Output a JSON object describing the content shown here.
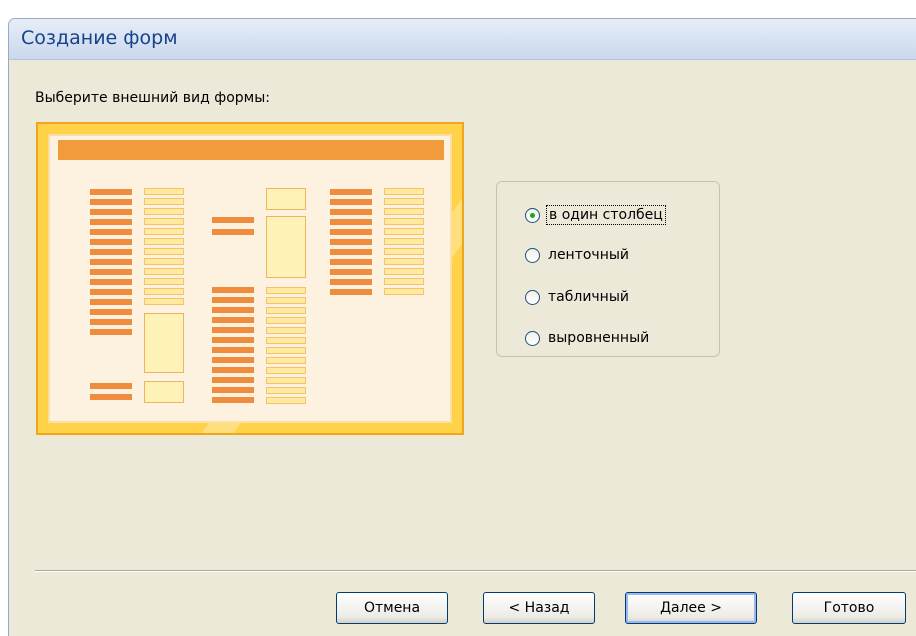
{
  "window": {
    "title": "Создание форм"
  },
  "prompt": "Выберите внешний вид формы:",
  "layout_options": [
    {
      "label": "в один столбец",
      "checked": true,
      "focused": true
    },
    {
      "label": "ленточный",
      "checked": false,
      "focused": false
    },
    {
      "label": "табличный",
      "checked": false,
      "focused": false
    },
    {
      "label": "выровненный",
      "checked": false,
      "focused": false
    }
  ],
  "buttons": {
    "cancel": "Отмена",
    "back": "< Назад",
    "next": "Далее >",
    "finish": "Готово"
  },
  "colors": {
    "title_text": "#15428b",
    "preview_orange": "#f29b3d",
    "preview_gold": "#ffd24a",
    "dialog_bg": "#ece9d8"
  }
}
